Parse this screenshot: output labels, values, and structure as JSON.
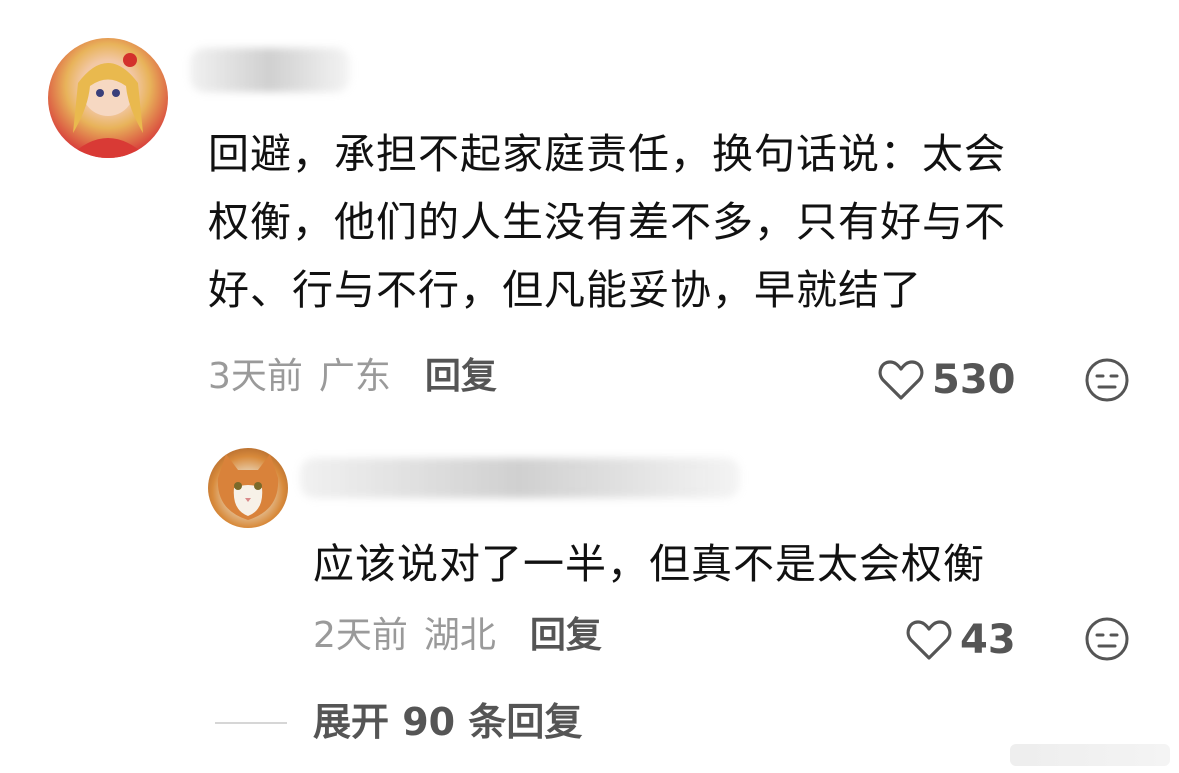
{
  "comment": {
    "text": "回避，承担不起家庭责任，换句话说：太会\n权衡，他们的人生没有差不多，只有好与不\n好、行与不行，但凡能妥协，早就结了",
    "time": "3天前",
    "location": "广东",
    "reply_label": "回复",
    "likes": "530"
  },
  "reply": {
    "text": "应该说对了一半，但真不是太会权衡",
    "time": "2天前",
    "location": "湖北",
    "reply_label": "回复",
    "likes": "43"
  },
  "expand": {
    "label": "展开 90 条回复"
  },
  "icons": {
    "like": "heart-outline-icon",
    "dislike": "neutral-face-icon"
  },
  "colors": {
    "text": "#111111",
    "meta": "#9a9a9a",
    "action": "#555555"
  }
}
